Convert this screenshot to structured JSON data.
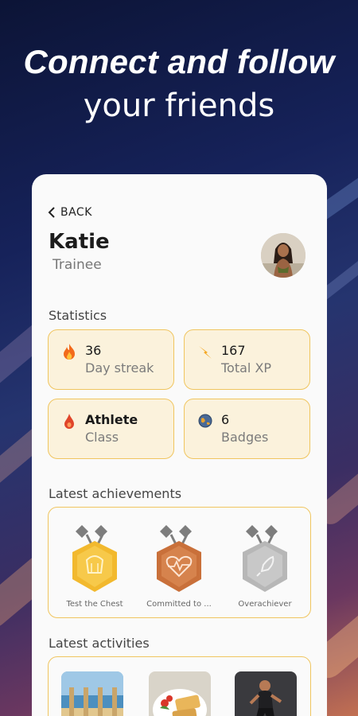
{
  "headline": {
    "line1": "Connect and follow",
    "line2": "your friends"
  },
  "profile": {
    "back_label": "BACK",
    "name": "Katie",
    "role": "Trainee"
  },
  "statistics": {
    "title": "Statistics",
    "items": [
      {
        "value": "36",
        "label": "Day streak",
        "icon": "fire-icon"
      },
      {
        "value": "167",
        "label": "Total XP",
        "icon": "lightning-icon"
      },
      {
        "value": "Athlete",
        "label": "Class",
        "icon": "flame-drop-icon"
      },
      {
        "value": "6",
        "label": "Badges",
        "icon": "globe-badge-icon"
      }
    ]
  },
  "achievements": {
    "title": "Latest achievements",
    "items": [
      {
        "label": "Test the Chest",
        "tier": "gold",
        "color": "#f2b92e"
      },
      {
        "label": "Committed to ...",
        "tier": "bronze",
        "color": "#c9703a"
      },
      {
        "label": "Overachiever",
        "tier": "silver",
        "color": "#b7b7b7"
      }
    ]
  },
  "activities": {
    "title": "Latest activities"
  },
  "colors": {
    "accent_border": "#f0c55f",
    "stat_bg": "#fbf2dc"
  }
}
